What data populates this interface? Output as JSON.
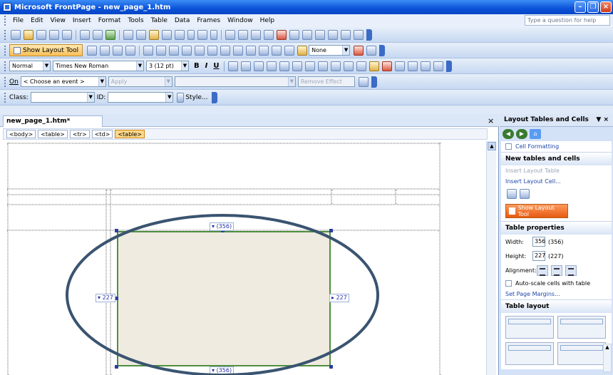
{
  "window": {
    "title": "Microsoft FrontPage - new_page_1.htm"
  },
  "menubar": {
    "items": [
      "File",
      "Edit",
      "View",
      "Insert",
      "Format",
      "Tools",
      "Table",
      "Data",
      "Frames",
      "Window",
      "Help"
    ],
    "ask_placeholder": "Type a question for help"
  },
  "toolbar_layout": {
    "show_layout_label": "Show Layout Tool",
    "none_combo": "None"
  },
  "toolbar_format": {
    "style": "Normal",
    "font": "Times New Roman",
    "size": "3 (12 pt)",
    "bold": "B",
    "italic": "I",
    "underline": "U"
  },
  "toolbar_dhtml": {
    "on_label": "On",
    "event_combo": "< Choose an event >",
    "apply_label": "Apply",
    "remove_effect": "Remove Effect"
  },
  "toolbar_class": {
    "class_label": "Class:",
    "id_label": "ID:",
    "style_button": "Style..."
  },
  "document": {
    "tab_label": "new_page_1.htm*",
    "close_glyph": "×",
    "quick_tags": [
      "<body>",
      "<table>",
      "<tr>",
      "<td>",
      "<table>"
    ],
    "cell": {
      "width_tag_top": "(356)",
      "width_tag_bottom": "(356)",
      "height_tag_left": "227",
      "height_tag_right": "227"
    }
  },
  "task_pane": {
    "title": "Layout Tables and Cells",
    "cell_formatting": "Cell Formatting",
    "section_new": "New tables and cells",
    "insert_layout_table": "Insert Layout Table",
    "insert_layout_cell": "Insert Layout Cell...",
    "show_layout_tool": "Show Layout Tool",
    "section_props": "Table properties",
    "width_label": "Width:",
    "width_value": "356",
    "width_actual": "(356)",
    "height_label": "Height:",
    "height_value": "227",
    "height_actual": "(227)",
    "alignment_label": "Alignment:",
    "autoscale": "Auto-scale cells with table",
    "set_margins": "Set Page Margins...",
    "section_layout": "Table layout"
  },
  "colors": {
    "title_blue": "#0a52d9",
    "cell_fill": "#efebe0",
    "cell_border": "#4f8f3f",
    "ellipse_stroke": "#3a5470",
    "show_layout_orange": "#e65a12"
  }
}
